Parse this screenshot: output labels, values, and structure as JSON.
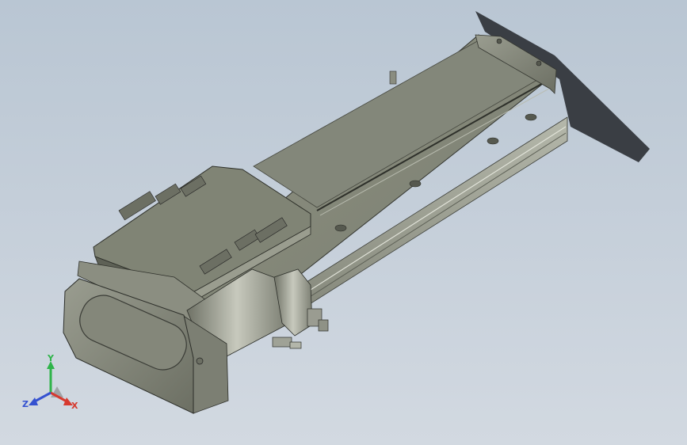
{
  "viewport": {
    "background_top": "#b9c6d3",
    "background_bottom": "#d2d9e1"
  },
  "model": {
    "body_color": "#8d9081",
    "top_face_color": "#7e8273",
    "rail_color": "#a7aa9e",
    "shadow_color": "#2f3237"
  },
  "triad": {
    "x_label": "X",
    "y_label": "Y",
    "z_label": "Z",
    "x_color": "#d63a2f",
    "y_color": "#2fb44a",
    "z_color": "#3552d0"
  }
}
